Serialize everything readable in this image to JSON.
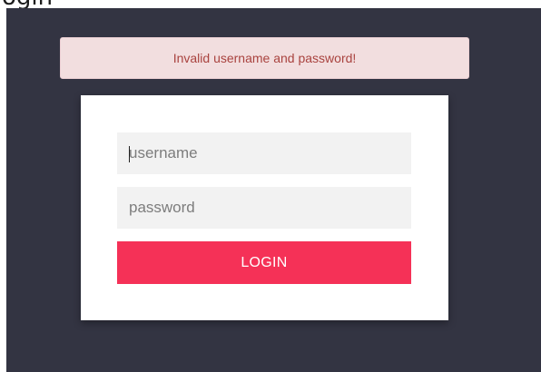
{
  "page": {
    "heading_partial": "ogin",
    "colors": {
      "background": "#333442",
      "alert_bg": "#f2dedf",
      "alert_text": "#a9433f",
      "button": "#f53157"
    }
  },
  "alert": {
    "message": "Invalid username and password!"
  },
  "login_form": {
    "username_placeholder": "username",
    "username_value": "",
    "password_placeholder": "password",
    "password_value": "",
    "submit_label": "LOGIN"
  }
}
